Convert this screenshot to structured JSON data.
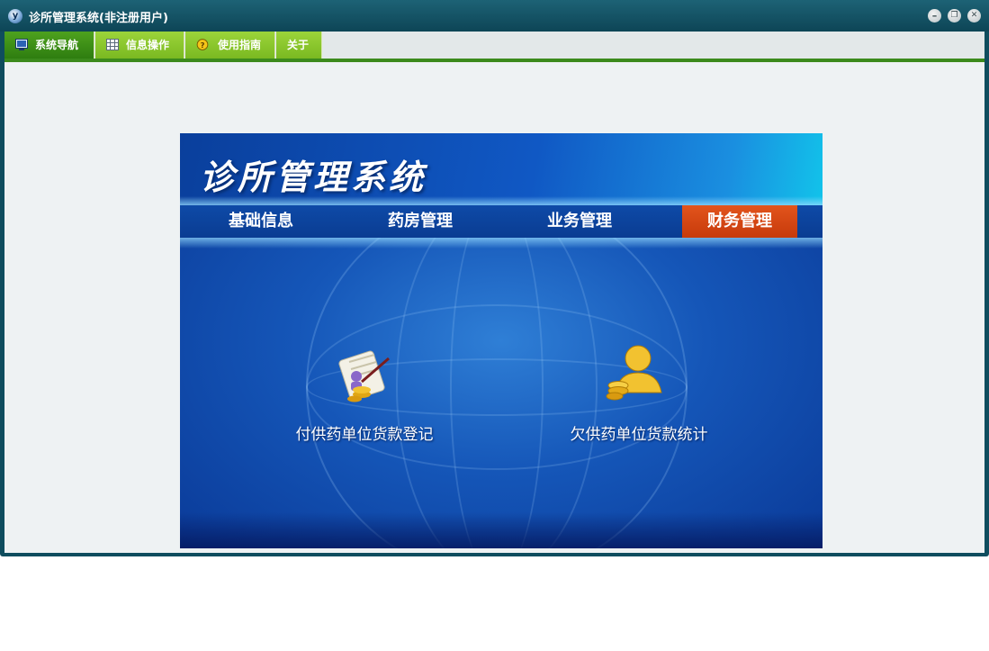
{
  "window": {
    "title": "诊所管理系统(非注册用户)",
    "app_icon_letter": "y",
    "buttons": {
      "minimize": "–",
      "restore": "❐",
      "close": "✕"
    }
  },
  "menu": {
    "tabs": [
      {
        "label": "系统导航",
        "icon": "monitor-icon",
        "active": true
      },
      {
        "label": "信息操作",
        "icon": "grid-icon",
        "active": false
      },
      {
        "label": "使用指南",
        "icon": "help-icon",
        "active": false
      },
      {
        "label": "关于",
        "icon": "",
        "active": false
      }
    ]
  },
  "panel": {
    "title": "诊所管理系统",
    "nav": [
      {
        "label": "基础信息",
        "active": false
      },
      {
        "label": "药房管理",
        "active": false
      },
      {
        "label": "业务管理",
        "active": false
      },
      {
        "label": "财务管理",
        "active": true
      }
    ],
    "functions": [
      {
        "label": "付供药单位货款登记",
        "icon": "scroll-coins-icon"
      },
      {
        "label": "欠供药单位货款统计",
        "icon": "user-coins-icon"
      }
    ]
  },
  "colors": {
    "titlebar": "#0d4556",
    "active_tab": "#2e7d10",
    "tab": "#7ab921",
    "panel_blue": "#1556b8",
    "active_nav": "#c73a0b"
  }
}
